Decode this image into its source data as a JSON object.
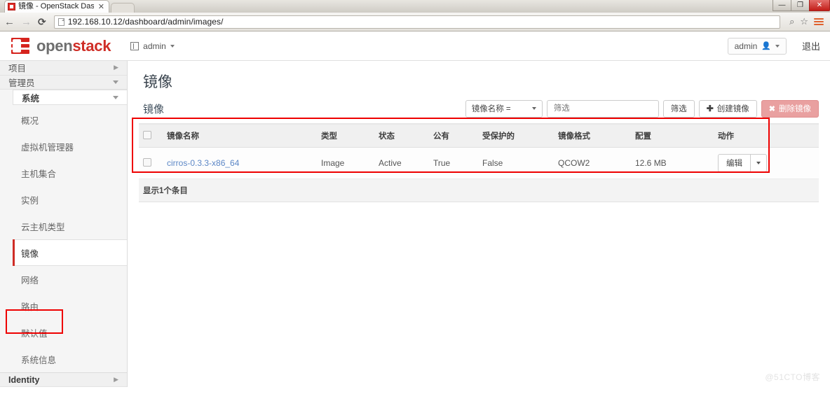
{
  "browser": {
    "tab_title": "镜像 - OpenStack Dashl",
    "tab_close": "✕",
    "url": "192.168.10.12/dashboard/admin/images/",
    "back_icon": "←",
    "forward_icon": "→",
    "reload_icon": "⟳",
    "zoom_icon": "⌕",
    "star_icon": "☆",
    "minimize_label": "—",
    "maximize_label": "❐",
    "close_label": "✕"
  },
  "header": {
    "logo_open": "open",
    "logo_stack": "stack",
    "project_label": "admin",
    "user_label": "admin",
    "user_icon": "person-icon",
    "logout_label": "退出"
  },
  "sidebar": {
    "groups": [
      {
        "label": "项目",
        "expanded": false
      },
      {
        "label": "管理员",
        "expanded": true
      }
    ],
    "sub_group": "系统",
    "items": [
      {
        "label": "概况",
        "active": false
      },
      {
        "label": "虚拟机管理器",
        "active": false
      },
      {
        "label": "主机集合",
        "active": false
      },
      {
        "label": "实例",
        "active": false
      },
      {
        "label": "云主机类型",
        "active": false
      },
      {
        "label": "镜像",
        "active": true
      },
      {
        "label": "网络",
        "active": false
      },
      {
        "label": "路由",
        "active": false
      },
      {
        "label": "默认值",
        "active": false
      },
      {
        "label": "系统信息",
        "active": false
      }
    ],
    "bottom_group": "Identity"
  },
  "main": {
    "page_title": "镜像",
    "table_title": "镜像",
    "toolbar": {
      "filter_field_label": "镜像名称 =",
      "filter_placeholder": "筛选",
      "filter_value": "",
      "filter_button": "筛选",
      "create_button": "创建镜像",
      "create_icon": "✚",
      "delete_button": "删除镜像",
      "delete_icon": "✖"
    },
    "table": {
      "columns": [
        "",
        "镜像名称",
        "类型",
        "状态",
        "公有",
        "受保护的",
        "镜像格式",
        "配置",
        "动作"
      ],
      "rows": [
        {
          "name": "cirros-0.3.3-x86_64",
          "type": "Image",
          "status": "Active",
          "public": "True",
          "protected": "False",
          "format": "QCOW2",
          "size": "12.6 MB",
          "action_label": "编辑"
        }
      ],
      "footer": "显示1个条目"
    }
  },
  "watermark": "@51CTO博客",
  "colors": {
    "brand_red": "#cf2d26",
    "link_blue": "#5c87c6",
    "annotation_red": "#ee0000",
    "danger_disabled": "#e9a0a0"
  }
}
